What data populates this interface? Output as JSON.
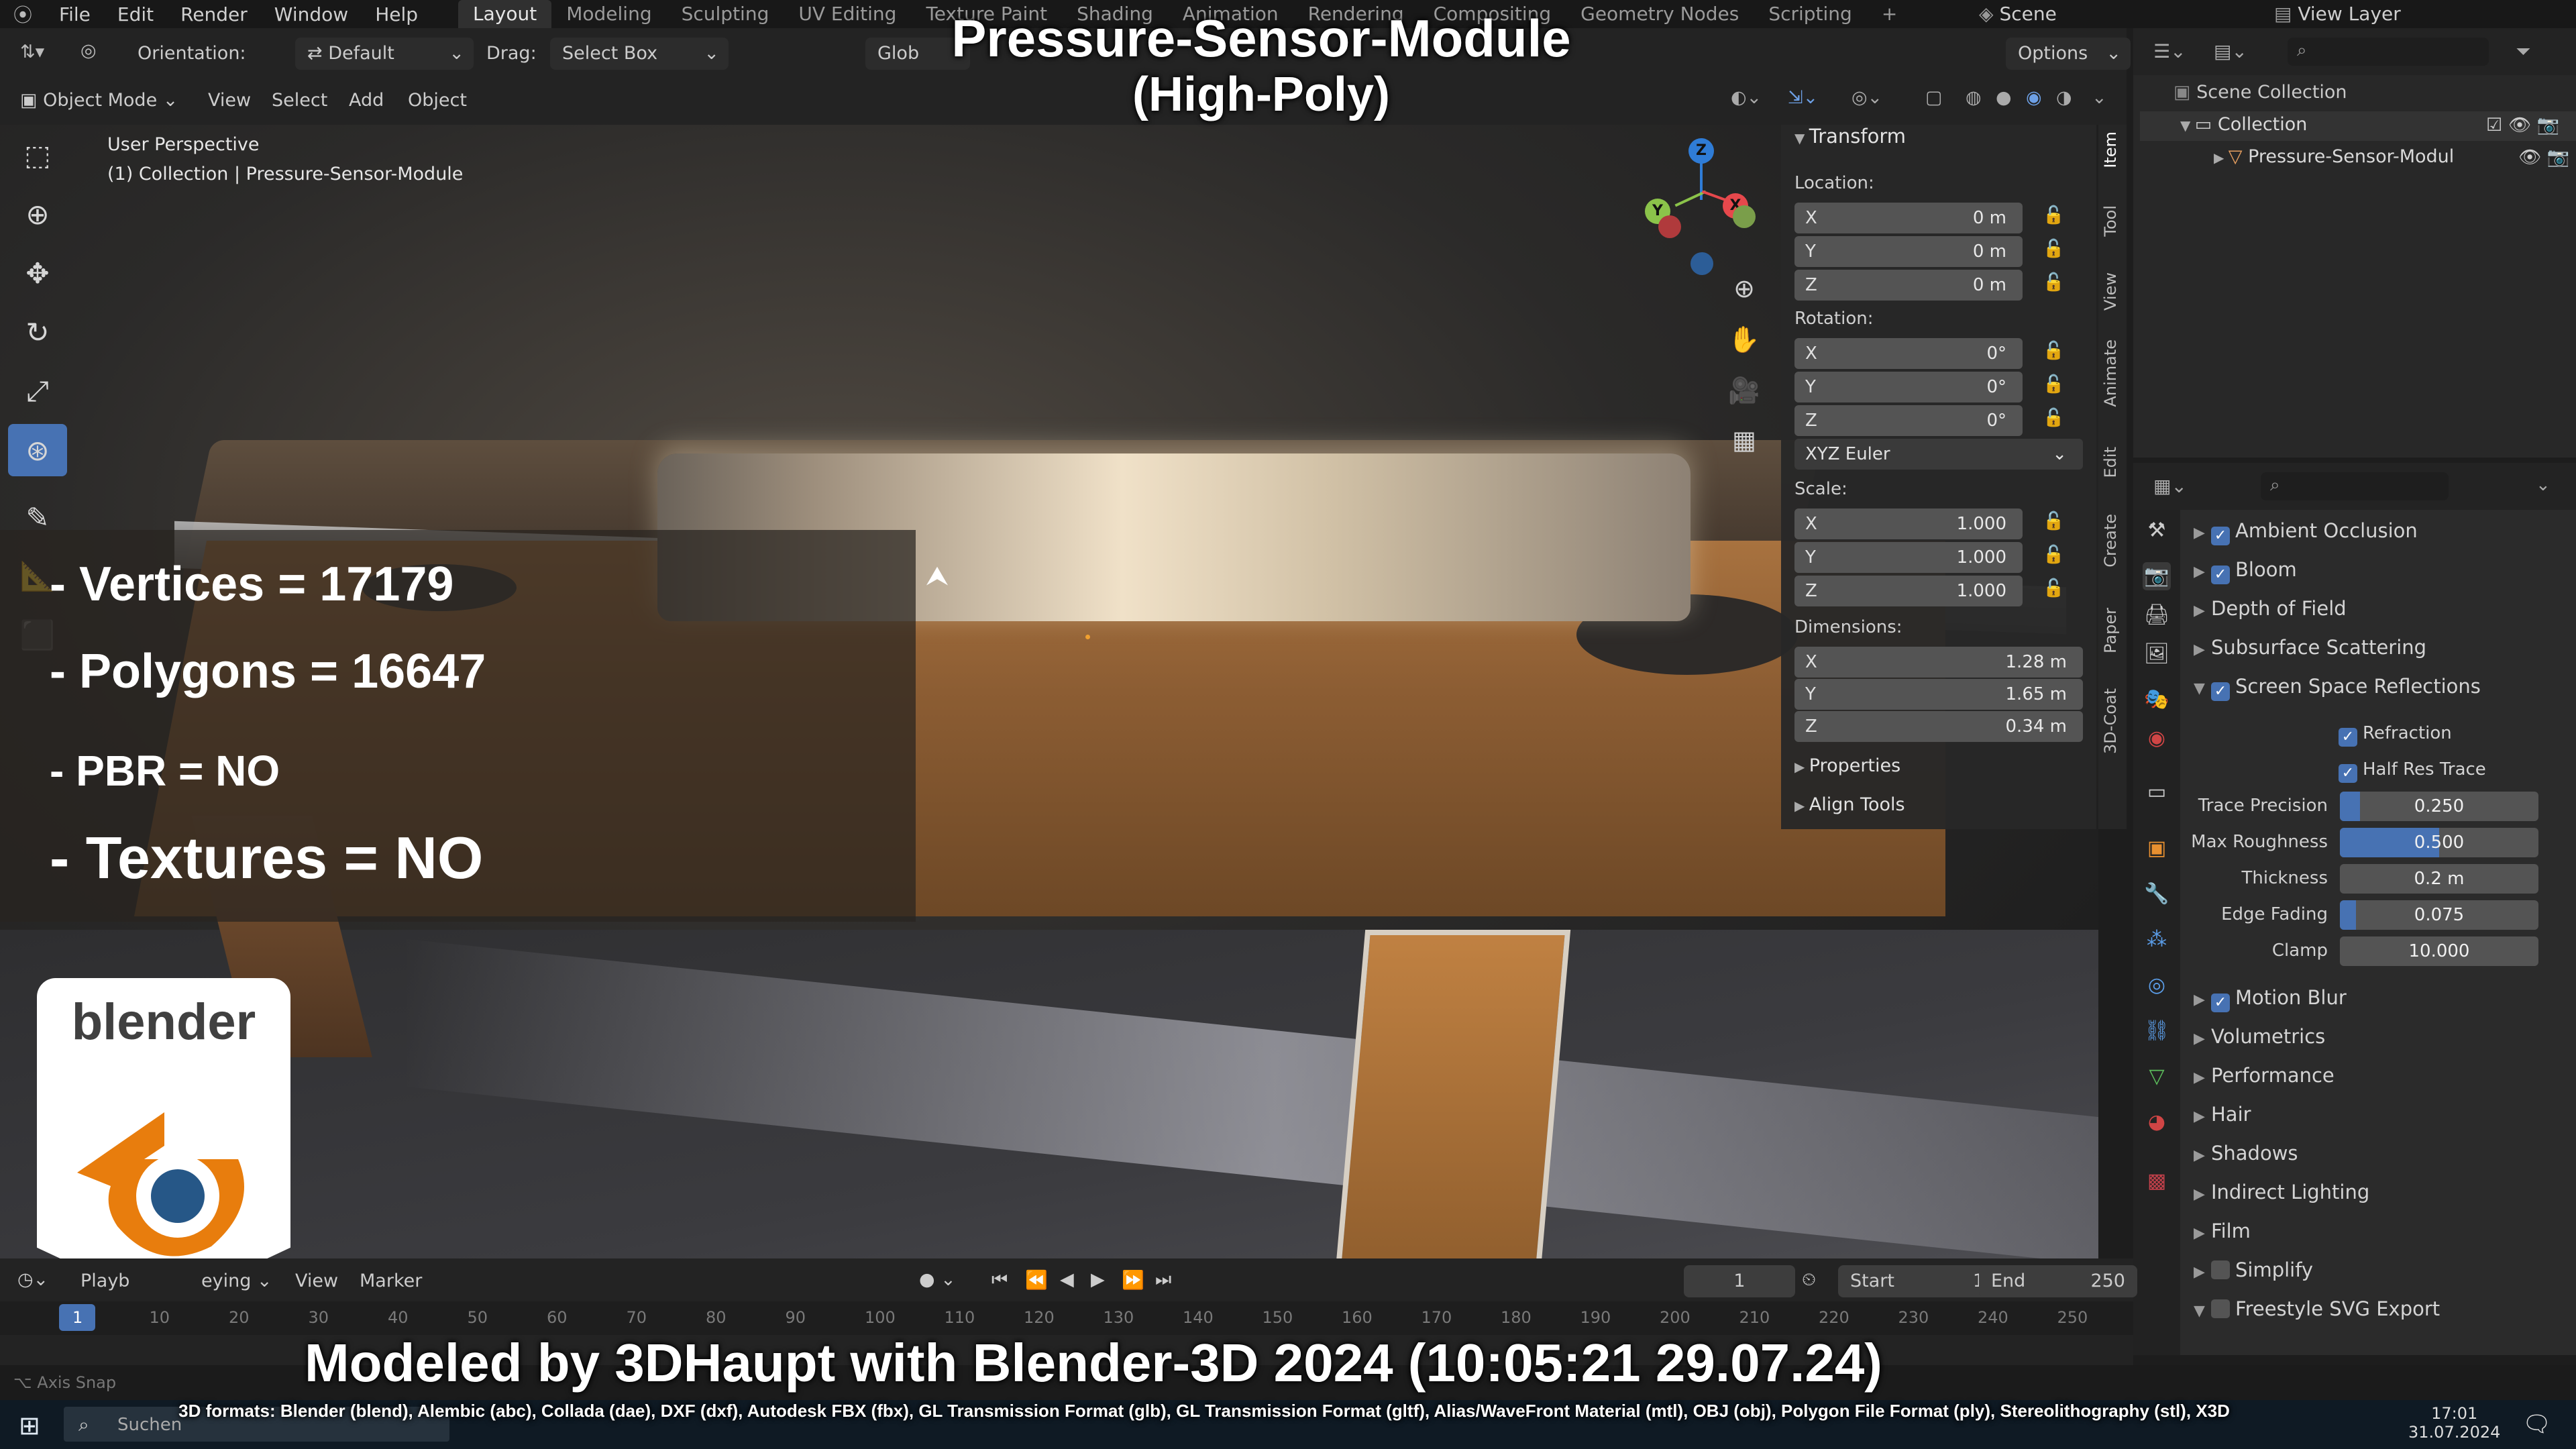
{
  "menu": {
    "items": [
      "File",
      "Edit",
      "Render",
      "Window",
      "Help"
    ]
  },
  "workspaces": [
    "Layout",
    "Modeling",
    "Sculpting",
    "UV Editing",
    "Texture Paint",
    "Shading",
    "Animation",
    "Rendering",
    "Compositing",
    "Geometry Nodes",
    "Scripting"
  ],
  "scene": {
    "name": "Scene",
    "view_layer": "View Layer"
  },
  "header": {
    "orientation_label": "Orientation:",
    "orientation_value": "Default",
    "drag_label": "Drag:",
    "drag_value": "Select Box",
    "global": "Glob",
    "options": "Options",
    "mode": "Object Mode",
    "view": "View",
    "select": "Select",
    "add": "Add",
    "object": "Object"
  },
  "viewport": {
    "perspective": "User Perspective",
    "collection_path": "(1) Collection | Pressure-Sensor-Module"
  },
  "gizmo": {
    "z": "Z",
    "y": "Y",
    "x": "X"
  },
  "title": {
    "line1": "Pressure-Sensor-Module",
    "line2": "(High-Poly)"
  },
  "stats": {
    "vertices": "- Vertices = 17179",
    "polygons": "- Polygons = 16647",
    "pbr": "- PBR =  NO",
    "textures": "- Textures = NO"
  },
  "logo_text": "blender",
  "npanel": {
    "transform": "Transform",
    "location": "Location:",
    "rotation": "Rotation:",
    "scale": "Scale:",
    "dimensions": "Dimensions:",
    "loc": [
      {
        "axis": "X",
        "value": "0 m"
      },
      {
        "axis": "Y",
        "value": "0 m"
      },
      {
        "axis": "Z",
        "value": "0 m"
      }
    ],
    "rot": [
      {
        "axis": "X",
        "value": "0°"
      },
      {
        "axis": "Y",
        "value": "0°"
      },
      {
        "axis": "Z",
        "value": "0°"
      }
    ],
    "rotation_mode": "XYZ Euler",
    "scl": [
      {
        "axis": "X",
        "value": "1.000"
      },
      {
        "axis": "Y",
        "value": "1.000"
      },
      {
        "axis": "Z",
        "value": "1.000"
      }
    ],
    "dim": [
      {
        "axis": "X",
        "value": "1.28 m"
      },
      {
        "axis": "Y",
        "value": "1.65 m"
      },
      {
        "axis": "Z",
        "value": "0.34 m"
      }
    ],
    "properties": "Properties",
    "align_tools": "Align Tools",
    "tabs": [
      "Item",
      "Tool",
      "View",
      "Animate",
      "Edit",
      "Create",
      "Paper",
      "3D-Coat"
    ]
  },
  "outliner": {
    "scene_collection": "Scene Collection",
    "collection": "Collection",
    "object": "Pressure-Sensor-Modul"
  },
  "properties": {
    "ambient_occlusion": "Ambient Occlusion",
    "bloom": "Bloom",
    "depth_of_field": "Depth of Field",
    "subsurface": "Subsurface Scattering",
    "ssr": "Screen Space Reflections",
    "refraction": "Refraction",
    "half_res": "Half Res Trace",
    "trace_precision": {
      "label": "Trace Precision",
      "value": "0.250",
      "fraction": 0.1
    },
    "max_roughness": {
      "label": "Max Roughness",
      "value": "0.500",
      "fraction": 0.5
    },
    "thickness": {
      "label": "Thickness",
      "value": "0.2 m",
      "fraction": 0.0
    },
    "edge_fading": {
      "label": "Edge Fading",
      "value": "0.075",
      "fraction": 0.08
    },
    "clamp": {
      "label": "Clamp",
      "value": "10.000",
      "fraction": 0.0
    },
    "motion_blur": "Motion Blur",
    "volumetrics": "Volumetrics",
    "performance": "Performance",
    "hair": "Hair",
    "shadows": "Shadows",
    "indirect": "Indirect Lighting",
    "film": "Film",
    "simplify": "Simplify",
    "freestyle": "Freestyle SVG Export"
  },
  "timeline": {
    "playback": "Playb",
    "keying": "eying",
    "view": "View",
    "marker": "Marker",
    "current_frame": "1",
    "start_label": "Start",
    "start": "1",
    "end_label": "End",
    "end": "250",
    "ticks": [
      "1",
      "10",
      "20",
      "30",
      "40",
      "50",
      "60",
      "70",
      "80",
      "90",
      "100",
      "110",
      "120",
      "130",
      "140",
      "150",
      "160",
      "170",
      "180",
      "190",
      "200",
      "210",
      "220",
      "230",
      "240",
      "250"
    ]
  },
  "status": {
    "axis_snap": "Axis Snap"
  },
  "credits": "Modeled by 3DHaupt with Blender-3D 2024 (10:05:21  29.07.24)",
  "formats": "3D formats: Blender (blend), Alembic (abc), Collada (dae), DXF (dxf), Autodesk FBX (fbx), GL Transmission Format (glb), GL Transmission Format (gltf), Alias/WaveFront Material (mtl), OBJ (obj), Polygon File Format (ply), Stereolithography (stl), X3D",
  "taskbar": {
    "search": "Suchen",
    "time": "17:01",
    "date": "31.07.2024"
  },
  "colors": {
    "accent": "#4772b3",
    "axis_x": "#e6484c",
    "axis_y": "#8bc34a",
    "axis_z": "#2f7cd6",
    "logo_orange": "#e87d0d",
    "logo_blue": "#265787"
  }
}
